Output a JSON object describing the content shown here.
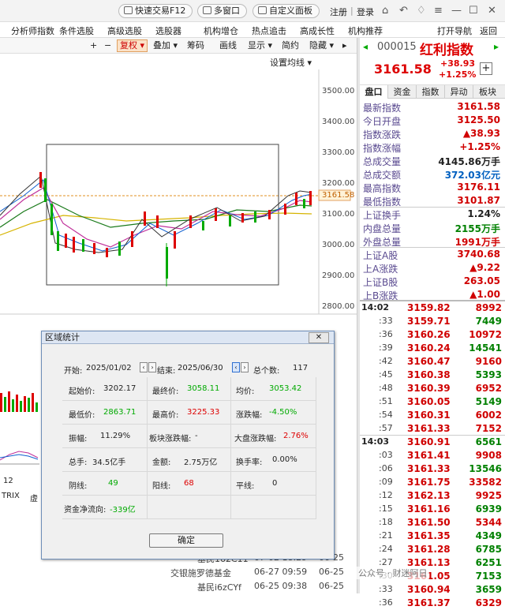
{
  "topbar": {
    "quick_trade": "快速交易F12",
    "multi_window": "多窗口",
    "custom_panel": "自定义面板",
    "register": "注册",
    "login": "登录"
  },
  "menu": [
    "分析师指数",
    "条件选股",
    "高级选股",
    "选股器",
    "机构增仓",
    "热点追击",
    "高成长性",
    "机构推荐",
    "打开导航",
    "返回"
  ],
  "chart_toolbar": {
    "plus": "+",
    "minus": "−",
    "fuquan": "复权",
    "diejia": "叠加",
    "chouma": "筹码",
    "huaxian": "画线",
    "xianshi": "显示",
    "jianyue": "简约",
    "yincang": "隐藏",
    "set_ma": "设置均线"
  },
  "chart": {
    "y_ticks": [
      "3500.00",
      "3400.00",
      "3300.00",
      "3200.00",
      "3100.00",
      "3000.00",
      "2900.00",
      "2800.00"
    ],
    "last_price_tag": "3161.58",
    "left_labels": {
      "n12": "12",
      "trix": "TRIX",
      "xu": "虚"
    }
  },
  "stock": {
    "code": "000015",
    "name": "红利指数",
    "price": "3161.58",
    "change": "+38.93",
    "change_pct": "+1.25%",
    "add_btn": "+"
  },
  "tabs": [
    "盘口",
    "资金",
    "指数",
    "异动",
    "板块"
  ],
  "quote": [
    {
      "k": "最新指数",
      "v": "3161.58",
      "c": "red"
    },
    {
      "k": "今日开盘",
      "v": "3125.50",
      "c": "red"
    },
    {
      "k": "指数涨跌",
      "v": "▲38.93",
      "c": "red"
    },
    {
      "k": "指数涨幅",
      "v": "+1.25%",
      "c": "red"
    },
    {
      "k": "总成交量",
      "v": "4145.86万手",
      "c": "black"
    },
    {
      "k": "总成交额",
      "v": "372.03亿元",
      "c": "blue"
    },
    {
      "k": "最高指数",
      "v": "3176.11",
      "c": "red"
    },
    {
      "k": "最低指数",
      "v": "3101.87",
      "c": "red"
    },
    {
      "k": "上证换手",
      "v": "1.24%",
      "c": "black"
    },
    {
      "k": "内盘总量",
      "v": "2155万手",
      "c": "green"
    },
    {
      "k": "外盘总量",
      "v": "1991万手",
      "c": "red"
    },
    {
      "k": "上证A股",
      "v": "3740.68",
      "c": "red"
    },
    {
      "k": "上A涨跌",
      "v": "▲9.22",
      "c": "red"
    },
    {
      "k": "上证B股",
      "v": "263.05",
      "c": "red"
    },
    {
      "k": "上B涨跌",
      "v": "▲1.00",
      "c": "red"
    }
  ],
  "ticks": [
    {
      "t": "14:02",
      "p": "3159.82",
      "q": "8992",
      "qc": "red"
    },
    {
      "t": ":33",
      "p": "3159.71",
      "q": "7449",
      "qc": "green"
    },
    {
      "t": ":36",
      "p": "3160.26",
      "q": "10972",
      "qc": "red"
    },
    {
      "t": ":39",
      "p": "3160.24",
      "q": "14541",
      "qc": "green"
    },
    {
      "t": ":42",
      "p": "3160.47",
      "q": "9160",
      "qc": "red"
    },
    {
      "t": ":45",
      "p": "3160.38",
      "q": "5393",
      "qc": "green"
    },
    {
      "t": ":48",
      "p": "3160.39",
      "q": "6952",
      "qc": "red"
    },
    {
      "t": ":51",
      "p": "3160.05",
      "q": "5149",
      "qc": "green"
    },
    {
      "t": ":54",
      "p": "3160.31",
      "q": "6002",
      "qc": "red"
    },
    {
      "t": ":57",
      "p": "3161.33",
      "q": "7152",
      "qc": "red"
    },
    {
      "t": "14:03",
      "p": "3160.91",
      "q": "6561",
      "qc": "green"
    },
    {
      "t": ":03",
      "p": "3161.41",
      "q": "9908",
      "qc": "red"
    },
    {
      "t": ":06",
      "p": "3161.33",
      "q": "13546",
      "qc": "green"
    },
    {
      "t": ":09",
      "p": "3161.75",
      "q": "33582",
      "qc": "red"
    },
    {
      "t": ":12",
      "p": "3162.13",
      "q": "9925",
      "qc": "red"
    },
    {
      "t": ":15",
      "p": "3161.16",
      "q": "6939",
      "qc": "green"
    },
    {
      "t": ":18",
      "p": "3161.50",
      "q": "5344",
      "qc": "red"
    },
    {
      "t": ":21",
      "p": "3161.35",
      "q": "4349",
      "qc": "green"
    },
    {
      "t": ":24",
      "p": "3161.28",
      "q": "6785",
      "qc": "green"
    },
    {
      "t": ":27",
      "p": "3161.13",
      "q": "6251",
      "qc": "green"
    },
    {
      "t": ":30",
      "p": "3161.05",
      "q": "7153",
      "qc": "green"
    },
    {
      "t": ":33",
      "p": "3160.94",
      "q": "3659",
      "qc": "green"
    },
    {
      "t": ":36",
      "p": "3161.37",
      "q": "6329",
      "qc": "red"
    }
  ],
  "bottom_list": [
    {
      "a": "基民162C11",
      "b": "07-02 18:29",
      "c": "06-25"
    },
    {
      "a": "交银施罗德基金",
      "b": "06-27 09:59",
      "c": "06-25"
    },
    {
      "a": "基民i6zCYf",
      "b": "06-25 09:38",
      "c": "06-25"
    }
  ],
  "watermark": "公众号 · 财迷阿日",
  "dialog": {
    "title": "区域统计",
    "close": "✕",
    "start_label": "开始:",
    "start_date": "2025/01/02",
    "end_label": "结束:",
    "end_date": "2025/06/30",
    "total_label": "总个数:",
    "total": "117",
    "open_label": "起始价:",
    "open": "3202.17",
    "close_label": "最终价:",
    "close_val": "3058.11",
    "avg_label": "均价:",
    "avg": "3053.42",
    "low_label": "最低价:",
    "low": "2863.71",
    "high_label": "最高价:",
    "high": "3225.33",
    "chg_label": "涨跌幅:",
    "chg": "-4.50%",
    "amp_label": "振幅:",
    "amp": "11.29%",
    "sector_label": "板块涨跌幅:",
    "sector": "-",
    "market_label": "大盘涨跌幅:",
    "market": "2.76%",
    "vol_label": "总手:",
    "vol": "34.5亿手",
    "amt_label": "金额:",
    "amt": "2.75万亿",
    "turn_label": "换手率:",
    "turn": "0.00%",
    "neg_label": "阴线:",
    "neg": "49",
    "pos_label": "阳线:",
    "pos": "68",
    "flat_label": "平线:",
    "flat": "0",
    "flow_label": "资金净流向:",
    "flow": "-339亿",
    "ok": "确定"
  }
}
